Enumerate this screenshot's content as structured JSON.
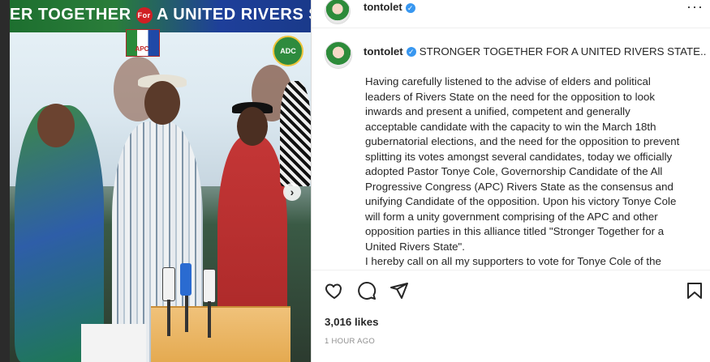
{
  "photo": {
    "banner_text": "ER TOGETHER",
    "banner_for": "For",
    "banner_text_2": "A UNITED RIVERS STATE",
    "apc_logo_text": "APC",
    "adc_logo_text": "ADC"
  },
  "post": {
    "username": "tontolet",
    "caption_title": "STRONGER TOGETHER FOR A UNITED RIVERS STATE..",
    "caption_paragraphs": [
      "Having carefully listened to the advise of elders and political leaders of Rivers State on the need for the opposition to look inwards and present a unified, competent and generally acceptable candidate with the capacity to win the March 18th gubernatorial elections, and the need for the opposition to prevent splitting its votes amongst several candidates, today we officially adopted Pastor Tonye Cole, Governorship Candidate of the All Progressive Congress (APC) Rivers State as the consensus and unifying Candidate of the opposition. Upon his victory Tonye Cole will form a unity government comprising of the APC and other opposition parties in this alliance titled \"Stronger Together for a United Rivers State\".",
      "I hereby call on all my supporters to vote for Tonye Cole of the APC this Saturday."
    ],
    "likes": "3,016 likes",
    "timestamp": "1 HOUR AGO"
  },
  "icons": {
    "verified": "verified-badge-icon",
    "more": "more-options-icon",
    "like": "heart-icon",
    "comment": "comment-icon",
    "share": "paper-plane-icon",
    "save": "bookmark-icon",
    "next": "chevron-right-icon"
  },
  "colors": {
    "verified": "#3897f0",
    "text": "#262626",
    "muted": "#8e8e8e"
  }
}
